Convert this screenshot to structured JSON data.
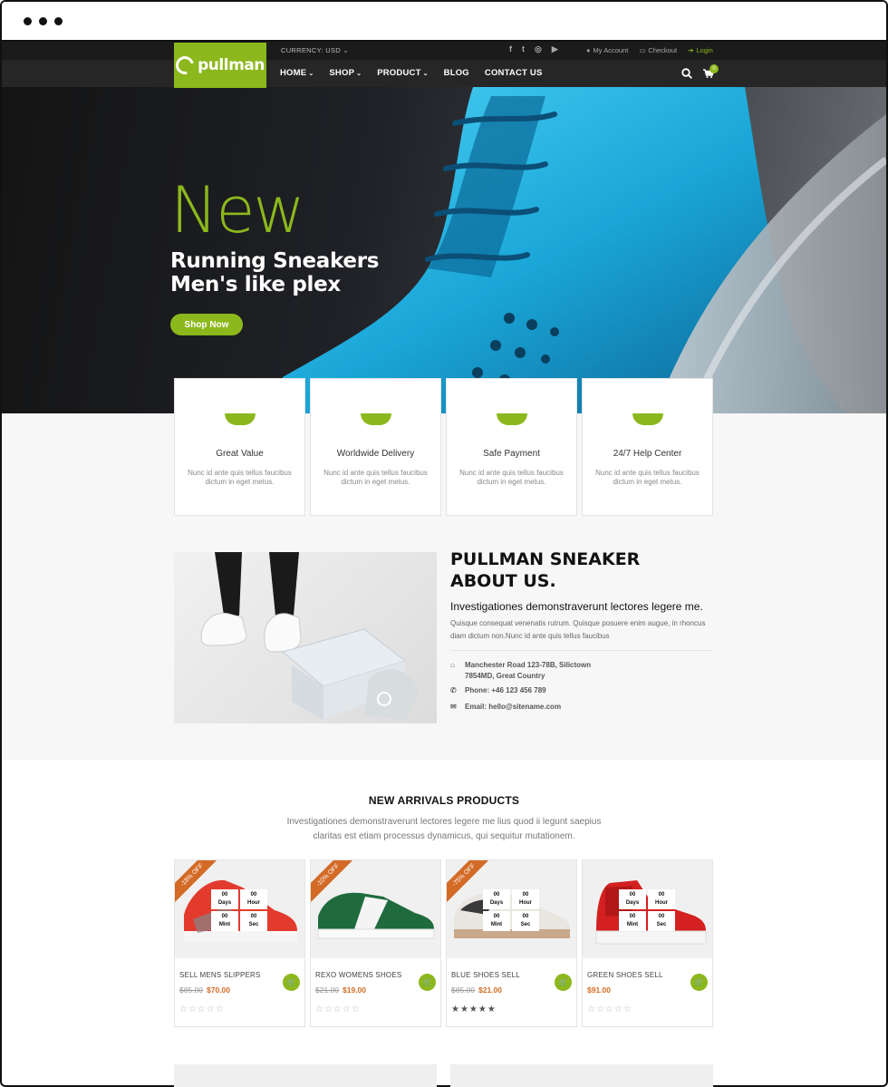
{
  "header": {
    "brand": "pullman",
    "currency": "CURRENCY: USD",
    "currency_caret": "⌄",
    "social_icons": [
      "facebook-icon",
      "twitter-icon",
      "instagram-icon",
      "youtube-icon"
    ],
    "social_glyphs": [
      "f",
      "t",
      "◎",
      "▶"
    ],
    "account": {
      "my_account": "My Account",
      "checkout": "Checkout",
      "login": "Login"
    },
    "menu": [
      {
        "label": "HOME",
        "caret": "⌄",
        "active": true
      },
      {
        "label": "SHOP",
        "caret": "⌄"
      },
      {
        "label": "PRODUCT",
        "caret": "⌄"
      },
      {
        "label": "BLOG",
        "caret": ""
      },
      {
        "label": "CONTACT US",
        "caret": ""
      }
    ],
    "cart_count": "0"
  },
  "hero": {
    "headline": "New",
    "line1": "Running Sneakers",
    "line2": "Men's like plex",
    "cta": "Shop Now"
  },
  "features": [
    {
      "title": "Great Value",
      "text": "Nunc id ante quis tellus faucibus dictum in eget metus."
    },
    {
      "title": "Worldwide Delivery",
      "text": "Nunc id ante quis tellus faucibus dictum in eget metus."
    },
    {
      "title": "Safe Payment",
      "text": "Nunc id ante quis tellus faucibus dictum in eget metus."
    },
    {
      "title": "24/7 Help Center",
      "text": "Nunc id ante quis tellus faucibus dictum in eget metus."
    }
  ],
  "about": {
    "title_line1": "PULLMAN SNEAKER",
    "title_line2": "ABOUT US.",
    "subtitle": "Investigationes demonstraverunt lectores legere me.",
    "text": "Quisque consequat venenatis rutrum. Quisque posuere enim augue, in rhoncus diam dictum non.Nunc id ante quis tellus faucibus",
    "address_line1": "Manchester Road 123-78B, Silictown",
    "address_line2": "7854MD, Great Country",
    "phone": "Phone: +46 123 456 789",
    "email": "Email: hello@sitename.com"
  },
  "arrivals": {
    "title": "NEW ARRIVALS PRODUCTS",
    "desc": "Investigationes demonstraverunt lectores legere me lius quod ii legunt saepius claritas est etiam processus dynamicus, qui sequitur mutationem.",
    "timer_labels": {
      "days": "Days",
      "hour": "Hour",
      "mint": "Mint",
      "sec": "Sec",
      "value": "00"
    },
    "products": [
      {
        "name": "SELL MENS SLIPPERS",
        "old": "$85.00",
        "price": "$70.00",
        "badge": "-18% OFF",
        "stars": "☆☆☆☆☆"
      },
      {
        "name": "REXO WOMENS SHOES",
        "old": "$21.00",
        "price": "$19.00",
        "badge": "-10% OFF",
        "stars": "☆☆☆☆☆"
      },
      {
        "name": "BLUE SHOES SELL",
        "old": "$85.00",
        "price": "$21.00",
        "badge": "-75% OFF",
        "stars": "★★★★★"
      },
      {
        "name": "GREEN SHOES SELL",
        "old": "",
        "price": "$91.00",
        "badge": "",
        "stars": "☆☆☆☆☆"
      }
    ]
  },
  "colors": {
    "accent": "#8cb81d",
    "sale": "#d36b26",
    "dark": "#1b1b1b"
  }
}
